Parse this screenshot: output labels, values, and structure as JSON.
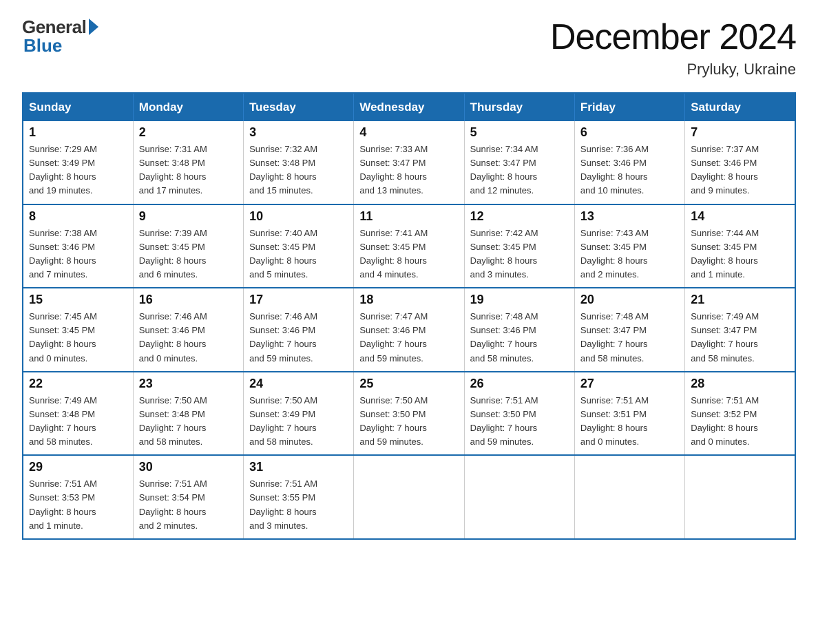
{
  "logo": {
    "general": "General",
    "blue": "Blue"
  },
  "title": {
    "month": "December 2024",
    "location": "Pryluky, Ukraine"
  },
  "weekdays": [
    "Sunday",
    "Monday",
    "Tuesday",
    "Wednesday",
    "Thursday",
    "Friday",
    "Saturday"
  ],
  "weeks": [
    [
      {
        "day": "1",
        "sunrise": "7:29 AM",
        "sunset": "3:49 PM",
        "daylight": "8 hours and 19 minutes."
      },
      {
        "day": "2",
        "sunrise": "7:31 AM",
        "sunset": "3:48 PM",
        "daylight": "8 hours and 17 minutes."
      },
      {
        "day": "3",
        "sunrise": "7:32 AM",
        "sunset": "3:48 PM",
        "daylight": "8 hours and 15 minutes."
      },
      {
        "day": "4",
        "sunrise": "7:33 AM",
        "sunset": "3:47 PM",
        "daylight": "8 hours and 13 minutes."
      },
      {
        "day": "5",
        "sunrise": "7:34 AM",
        "sunset": "3:47 PM",
        "daylight": "8 hours and 12 minutes."
      },
      {
        "day": "6",
        "sunrise": "7:36 AM",
        "sunset": "3:46 PM",
        "daylight": "8 hours and 10 minutes."
      },
      {
        "day": "7",
        "sunrise": "7:37 AM",
        "sunset": "3:46 PM",
        "daylight": "8 hours and 9 minutes."
      }
    ],
    [
      {
        "day": "8",
        "sunrise": "7:38 AM",
        "sunset": "3:46 PM",
        "daylight": "8 hours and 7 minutes."
      },
      {
        "day": "9",
        "sunrise": "7:39 AM",
        "sunset": "3:45 PM",
        "daylight": "8 hours and 6 minutes."
      },
      {
        "day": "10",
        "sunrise": "7:40 AM",
        "sunset": "3:45 PM",
        "daylight": "8 hours and 5 minutes."
      },
      {
        "day": "11",
        "sunrise": "7:41 AM",
        "sunset": "3:45 PM",
        "daylight": "8 hours and 4 minutes."
      },
      {
        "day": "12",
        "sunrise": "7:42 AM",
        "sunset": "3:45 PM",
        "daylight": "8 hours and 3 minutes."
      },
      {
        "day": "13",
        "sunrise": "7:43 AM",
        "sunset": "3:45 PM",
        "daylight": "8 hours and 2 minutes."
      },
      {
        "day": "14",
        "sunrise": "7:44 AM",
        "sunset": "3:45 PM",
        "daylight": "8 hours and 1 minute."
      }
    ],
    [
      {
        "day": "15",
        "sunrise": "7:45 AM",
        "sunset": "3:45 PM",
        "daylight": "8 hours and 0 minutes."
      },
      {
        "day": "16",
        "sunrise": "7:46 AM",
        "sunset": "3:46 PM",
        "daylight": "8 hours and 0 minutes."
      },
      {
        "day": "17",
        "sunrise": "7:46 AM",
        "sunset": "3:46 PM",
        "daylight": "7 hours and 59 minutes."
      },
      {
        "day": "18",
        "sunrise": "7:47 AM",
        "sunset": "3:46 PM",
        "daylight": "7 hours and 59 minutes."
      },
      {
        "day": "19",
        "sunrise": "7:48 AM",
        "sunset": "3:46 PM",
        "daylight": "7 hours and 58 minutes."
      },
      {
        "day": "20",
        "sunrise": "7:48 AM",
        "sunset": "3:47 PM",
        "daylight": "7 hours and 58 minutes."
      },
      {
        "day": "21",
        "sunrise": "7:49 AM",
        "sunset": "3:47 PM",
        "daylight": "7 hours and 58 minutes."
      }
    ],
    [
      {
        "day": "22",
        "sunrise": "7:49 AM",
        "sunset": "3:48 PM",
        "daylight": "7 hours and 58 minutes."
      },
      {
        "day": "23",
        "sunrise": "7:50 AM",
        "sunset": "3:48 PM",
        "daylight": "7 hours and 58 minutes."
      },
      {
        "day": "24",
        "sunrise": "7:50 AM",
        "sunset": "3:49 PM",
        "daylight": "7 hours and 58 minutes."
      },
      {
        "day": "25",
        "sunrise": "7:50 AM",
        "sunset": "3:50 PM",
        "daylight": "7 hours and 59 minutes."
      },
      {
        "day": "26",
        "sunrise": "7:51 AM",
        "sunset": "3:50 PM",
        "daylight": "7 hours and 59 minutes."
      },
      {
        "day": "27",
        "sunrise": "7:51 AM",
        "sunset": "3:51 PM",
        "daylight": "8 hours and 0 minutes."
      },
      {
        "day": "28",
        "sunrise": "7:51 AM",
        "sunset": "3:52 PM",
        "daylight": "8 hours and 0 minutes."
      }
    ],
    [
      {
        "day": "29",
        "sunrise": "7:51 AM",
        "sunset": "3:53 PM",
        "daylight": "8 hours and 1 minute."
      },
      {
        "day": "30",
        "sunrise": "7:51 AM",
        "sunset": "3:54 PM",
        "daylight": "8 hours and 2 minutes."
      },
      {
        "day": "31",
        "sunrise": "7:51 AM",
        "sunset": "3:55 PM",
        "daylight": "8 hours and 3 minutes."
      },
      null,
      null,
      null,
      null
    ]
  ],
  "labels": {
    "sunrise": "Sunrise:",
    "sunset": "Sunset:",
    "daylight": "Daylight:"
  }
}
